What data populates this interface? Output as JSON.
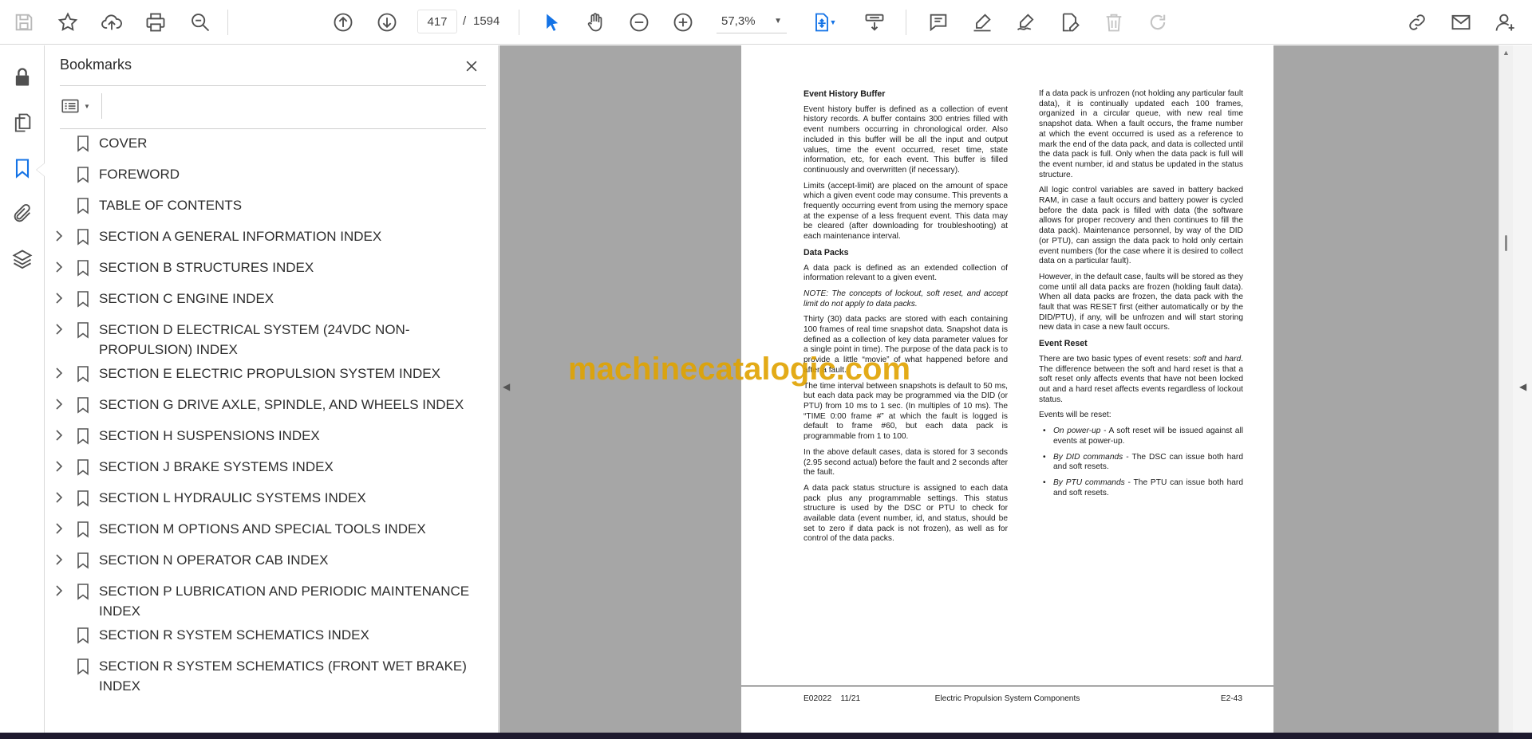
{
  "toolbar": {
    "page_current": "417",
    "page_separator": "/",
    "page_total": "1594",
    "zoom": "57,3%",
    "icons": [
      "save-icon",
      "star-icon",
      "upload-icon",
      "print-icon",
      "zoom-search-icon",
      "prev-page-icon",
      "next-page-icon",
      "select-cursor-icon",
      "hand-icon",
      "zoom-out-icon",
      "zoom-in-icon",
      "fit-page-icon",
      "scroll-mode-icon",
      "comment-icon",
      "highlight-icon",
      "sign-icon",
      "edit-fill-icon",
      "delete-icon",
      "redo-icon",
      "share-link-icon",
      "email-icon",
      "account-icon"
    ]
  },
  "rail": {
    "icons": [
      "lock-icon",
      "pages-icon",
      "bookmark-icon",
      "attachment-icon",
      "layers-icon"
    ]
  },
  "bookmarks": {
    "title": "Bookmarks",
    "items": [
      {
        "label": "COVER",
        "expandable": false
      },
      {
        "label": "FOREWORD",
        "expandable": false
      },
      {
        "label": "TABLE OF CONTENTS",
        "expandable": false
      },
      {
        "label": "SECTION A GENERAL INFORMATION INDEX",
        "expandable": true
      },
      {
        "label": "SECTION B STRUCTURES INDEX",
        "expandable": true
      },
      {
        "label": "SECTION C ENGINE INDEX",
        "expandable": true
      },
      {
        "label": "SECTION D ELECTRICAL SYSTEM (24VDC NON-PROPULSION) INDEX",
        "expandable": true
      },
      {
        "label": "SECTION E ELECTRIC PROPULSION SYSTEM INDEX",
        "expandable": true
      },
      {
        "label": "SECTION G DRIVE AXLE, SPINDLE, AND WHEELS INDEX",
        "expandable": true
      },
      {
        "label": "SECTION H SUSPENSIONS INDEX",
        "expandable": true
      },
      {
        "label": "SECTION J BRAKE SYSTEMS INDEX",
        "expandable": true
      },
      {
        "label": "SECTION L HYDRAULIC SYSTEMS INDEX",
        "expandable": true
      },
      {
        "label": "SECTION M OPTIONS AND SPECIAL TOOLS INDEX",
        "expandable": true
      },
      {
        "label": "SECTION N OPERATOR CAB INDEX",
        "expandable": true
      },
      {
        "label": "SECTION P LUBRICATION AND PERIODIC MAINTENANCE INDEX",
        "expandable": true
      },
      {
        "label": "SECTION R SYSTEM SCHEMATICS INDEX",
        "expandable": false
      },
      {
        "label": "SECTION R SYSTEM SCHEMATICS (FRONT WET BRAKE) INDEX",
        "expandable": false
      }
    ]
  },
  "document": {
    "left": {
      "h1": "Event History Buffer",
      "p1": "Event history buffer is defined as a collection of event history records. A buffer contains 300 entries filled with event numbers occurring in chronological order. Also included in this buffer will be all the input and output values, time the event occurred, reset time, state information, etc, for each event. This buffer is filled continuously and overwritten (if necessary).",
      "p2": "Limits (accept-limit) are placed on the amount of space which a given event code may consume. This prevents a frequently occurring event from using the memory space at the expense of a less frequent event. This data may be cleared (after downloading for troubleshooting) at each maintenance interval.",
      "h2": "Data Packs",
      "p3": "A data pack is defined as an extended collection of information relevant to a given event.",
      "note": "NOTE: The concepts of lockout, soft reset, and accept limit do not apply to data packs.",
      "p4": "Thirty (30) data packs are stored with each containing 100 frames of real time snapshot data. Snapshot data is defined as a collection of key data parameter values for a single point in time). The purpose of the data pack is to provide a little “movie” of what happened before and after a fault.",
      "p5": "The time interval between snapshots is default to 50 ms, but each data pack may be programmed via the DID (or PTU) from 10 ms to 1 sec. (In multiples of 10 ms). The “TIME 0:00 frame #” at which the fault is logged is default to frame #60, but each data pack is programmable from 1 to 100.",
      "p6": "In the above default cases, data is stored for 3 seconds (2.95 second actual) before the fault and 2 seconds after the fault.",
      "p7": "A data pack status structure is assigned to each data pack plus any programmable settings. This status structure is used by the DSC or PTU to check for available data (event number, id, and status, should be set to zero if data pack is not frozen), as well as for control of the data packs."
    },
    "right": {
      "p1": "If a data pack is unfrozen (not holding any particular fault data), it is continually updated each 100 frames, organized in a circular queue, with new real time snapshot data. When a fault occurs, the frame number at which the event occurred is used as a reference to mark the end of the data pack, and data is collected until the data pack is full. Only when the data pack is full will the event number, id and status be updated in the status structure.",
      "p2": "All logic control variables are saved in battery backed RAM, in case a fault occurs and battery power is cycled before the data pack is filled with data (the software allows for proper recovery and then continues to fill the data pack). Maintenance personnel, by way of the DID (or PTU), can assign the data pack to hold only certain event numbers (for the case where it is desired to collect data on a particular fault).",
      "p3": "However, in the default case, faults will be stored as they come until all data packs are frozen (holding fault data). When all data packs are frozen, the data pack with the fault that was RESET first (either automatically or by the DID/PTU), if any, will be unfrozen and will start storing new data in case a new fault occurs.",
      "h1": "Event Reset",
      "p4a": "There are two basic types of event resets: ",
      "p4b": "soft",
      "p4c": " and ",
      "p4d": "hard",
      "p4e": ". The difference between the soft and hard reset is that a soft reset only affects events that have not been locked out and a hard reset affects events regardless of lockout status.",
      "p5": "Events will be reset:",
      "b1_em": "On power-up",
      "b1": " - A soft reset will be issued against all events at power-up.",
      "b2_em": "By DID commands",
      "b2": " - The DSC can issue both hard and soft resets.",
      "b3_em": "By PTU commands",
      "b3": " - The PTU can issue both hard and soft resets."
    },
    "footer": {
      "code": "E02022    11/21",
      "title": "Electric Propulsion System Components",
      "page": "E2-43"
    },
    "watermark": "machinecatalogic.com"
  },
  "colors": {
    "accent": "#1473e6",
    "doc_background": "#a6a6a6",
    "watermark": "#e0a300"
  }
}
